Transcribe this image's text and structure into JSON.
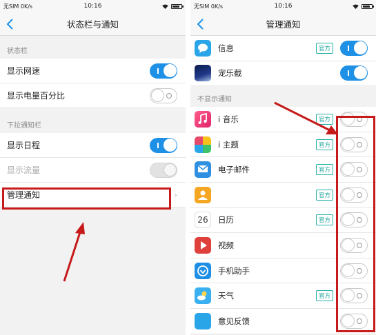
{
  "status": {
    "carrier": "无SIM 0K/s",
    "time": "10:16"
  },
  "left_screen": {
    "title": "状态栏与通知",
    "sections": [
      {
        "header": "状态栏",
        "rows": [
          {
            "label": "显示网速",
            "toggle": "on"
          },
          {
            "label": "显示电量百分比",
            "toggle": "off"
          }
        ]
      },
      {
        "header": "下拉通知栏",
        "rows": [
          {
            "label": "显示日程",
            "toggle": "on"
          },
          {
            "label": "显示流量",
            "toggle": "disabled"
          },
          {
            "label": "管理通知",
            "chevron": true
          }
        ]
      }
    ]
  },
  "right_screen": {
    "title": "管理通知",
    "shown_apps": [
      {
        "name": "信息",
        "official": true,
        "toggle": "on",
        "icon": "message-icon"
      },
      {
        "name": "宠乐截",
        "official": false,
        "toggle": "on",
        "icon": "photo-icon"
      }
    ],
    "hidden_header": "不显示通知",
    "hidden_apps": [
      {
        "name": "i 音乐",
        "official": true,
        "toggle": "off",
        "icon": "music-icon"
      },
      {
        "name": "i 主题",
        "official": true,
        "toggle": "off",
        "icon": "theme-icon"
      },
      {
        "name": "电子邮件",
        "official": true,
        "toggle": "off",
        "icon": "email-icon"
      },
      {
        "name": "",
        "official": true,
        "toggle": "off",
        "icon": "contacts-icon"
      },
      {
        "name": "日历",
        "official": true,
        "toggle": "off",
        "icon": "calendar-icon",
        "icon_text": "26"
      },
      {
        "name": "视频",
        "official": false,
        "toggle": "off",
        "icon": "video-icon"
      },
      {
        "name": "手机助手",
        "official": false,
        "toggle": "off",
        "icon": "assistant-icon"
      },
      {
        "name": "天气",
        "official": true,
        "toggle": "off",
        "icon": "weather-icon"
      },
      {
        "name": "意见反馈",
        "official": false,
        "toggle": "off",
        "icon": "feedback-icon"
      }
    ],
    "official_label": "官方"
  },
  "colors": {
    "toggle_on": "#1e90e6",
    "badge": "#26b0a6",
    "annotation": "#c71a1a",
    "back_arrow": "#1e90e6"
  }
}
